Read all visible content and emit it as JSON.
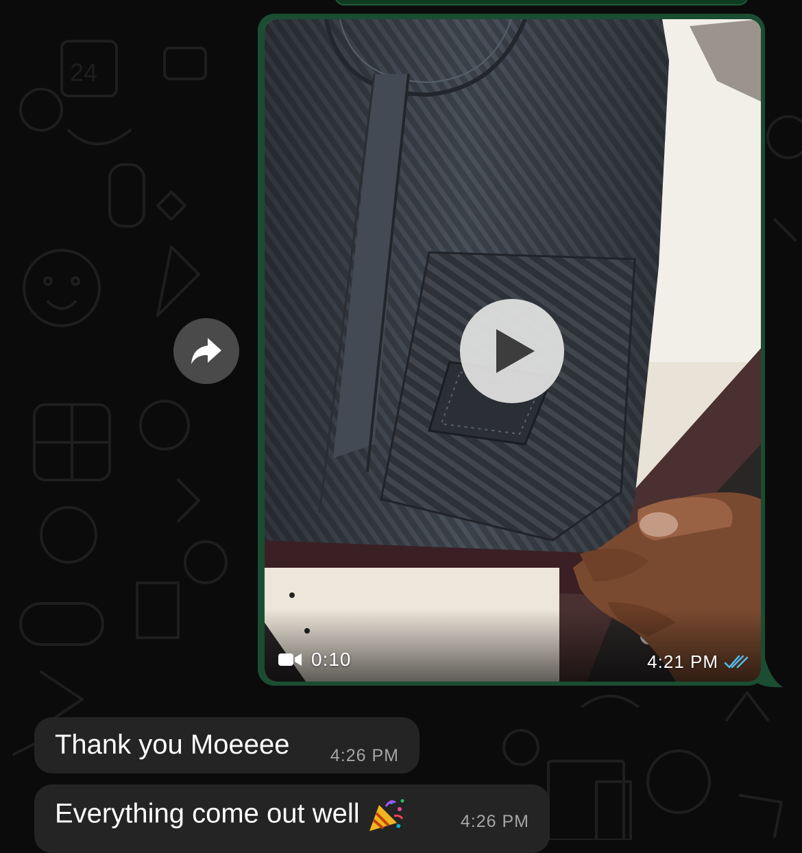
{
  "chat": {
    "video_message": {
      "duration": "0:10",
      "time": "4:21 PM",
      "status_icon": "double-check-icon",
      "media_icon": "video-camera-icon",
      "play_icon": "play-icon"
    },
    "forward_icon": "forward-arrow-icon",
    "messages": [
      {
        "text": "Thank you Moeeee",
        "time": "4:26 PM"
      },
      {
        "text": "Everything come out well",
        "emoji_icon": "party-popper-icon",
        "time": "4:26 PM"
      }
    ]
  },
  "colors": {
    "background": "#0b0b0b",
    "outgoing_bubble": "#1a4d31",
    "incoming_bubble": "#242424",
    "read_check": "#53bdeb",
    "timestamp": "#a6a6a6"
  }
}
